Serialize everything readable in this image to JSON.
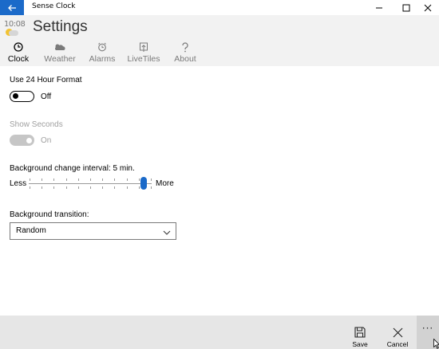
{
  "window": {
    "title": "Sense Clock"
  },
  "header": {
    "logo_time": "10:08",
    "page_title": "Settings",
    "tabs": [
      {
        "label": "Clock",
        "icon": "clock-icon",
        "active": true
      },
      {
        "label": "Weather",
        "icon": "weather-cloud-icon",
        "active": false
      },
      {
        "label": "Alarms",
        "icon": "alarm-icon",
        "active": false
      },
      {
        "label": "LiveTiles",
        "icon": "livetiles-icon",
        "active": false
      },
      {
        "label": "About",
        "icon": "question-icon",
        "active": false
      }
    ]
  },
  "settings": {
    "format24": {
      "label": "Use 24 Hour Format",
      "state": "Off"
    },
    "seconds": {
      "label": "Show Seconds",
      "state": "On",
      "disabled": true
    },
    "interval": {
      "label": "Background change interval:  5 min.",
      "min_label": "Less",
      "max_label": "More",
      "value_fraction": 0.96
    },
    "transition": {
      "label": "Background transition:",
      "selected": "Random"
    }
  },
  "commandbar": {
    "save_label": "Save",
    "cancel_label": "Cancel",
    "more_label": "···"
  },
  "colors": {
    "accent": "#1b6ac9",
    "header_bg": "#f2f2f2",
    "cmdbar_bg": "#e6e6e6"
  }
}
